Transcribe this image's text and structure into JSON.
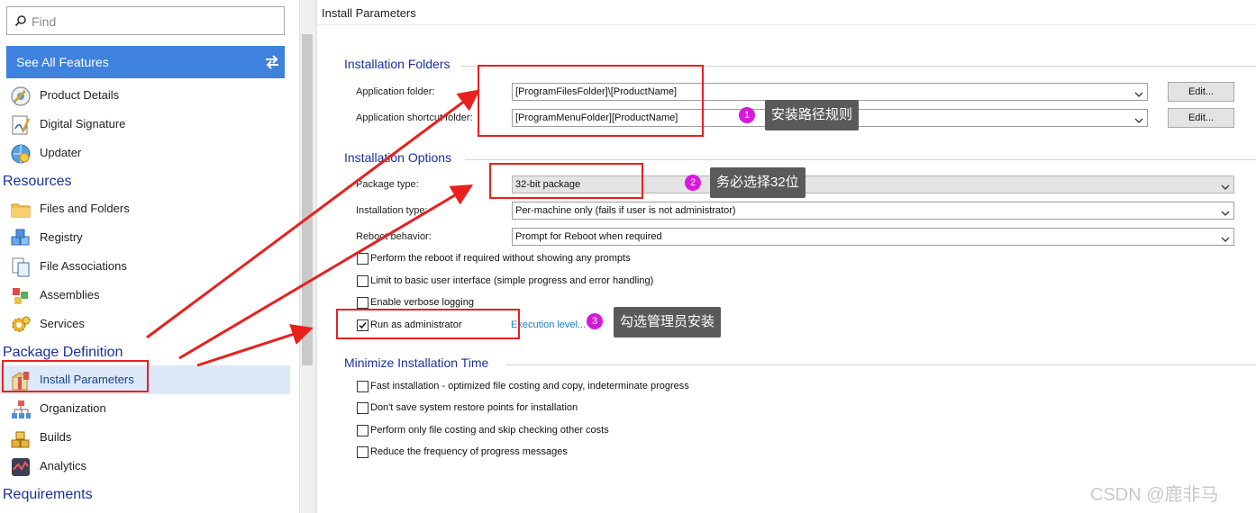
{
  "sidebar": {
    "search_placeholder": "Find",
    "see_all": "See All Features",
    "items_top": [
      {
        "label": "Product Details",
        "icon": "product-details-icon"
      },
      {
        "label": "Digital Signature",
        "icon": "digital-signature-icon"
      },
      {
        "label": "Updater",
        "icon": "updater-icon"
      }
    ],
    "sections": {
      "resources": "Resources",
      "package_definition": "Package Definition",
      "requirements": "Requirements"
    },
    "resources_items": [
      {
        "label": "Files and Folders",
        "icon": "folder-icon"
      },
      {
        "label": "Registry",
        "icon": "registry-icon"
      },
      {
        "label": "File Associations",
        "icon": "file-associations-icon"
      },
      {
        "label": "Assemblies",
        "icon": "assemblies-icon"
      },
      {
        "label": "Services",
        "icon": "services-gear-icon"
      }
    ],
    "package_items": [
      {
        "label": "Install Parameters",
        "icon": "install-parameters-icon",
        "selected": true
      },
      {
        "label": "Organization",
        "icon": "organization-icon"
      },
      {
        "label": "Builds",
        "icon": "builds-icon"
      },
      {
        "label": "Analytics",
        "icon": "analytics-icon"
      }
    ]
  },
  "main": {
    "title": "Install Parameters",
    "installation_folders": {
      "title": "Installation Folders",
      "app_folder_label": "Application folder:",
      "app_folder_value": "[ProgramFilesFolder]\\[ProductName]",
      "shortcut_folder_label": "Application shortcut folder:",
      "shortcut_folder_value": "[ProgramMenuFolder][ProductName]",
      "edit_label": "Edit..."
    },
    "installation_options": {
      "title": "Installation Options",
      "package_type_label": "Package type:",
      "package_type_value": "32-bit package",
      "installation_type_label": "Installation type:",
      "installation_type_value": "Per-machine only (fails if user is not administrator)",
      "reboot_label": "Reboot behavior:",
      "reboot_value": "Prompt for Reboot when required",
      "checkboxes": [
        {
          "label": "Perform the reboot if required without showing any prompts",
          "checked": false
        },
        {
          "label": "Limit to basic user interface (simple progress and error handling)",
          "checked": false
        },
        {
          "label": "Enable verbose logging",
          "checked": false
        },
        {
          "label": "Run as administrator",
          "checked": true
        }
      ],
      "execution_level_link": "Execution level..."
    },
    "minimize_installation_time": {
      "title": "Minimize Installation Time",
      "checkboxes": [
        {
          "label": "Fast installation - optimized file costing and copy, indeterminate progress",
          "checked": false
        },
        {
          "label": "Don't save system restore points for installation",
          "checked": false
        },
        {
          "label": "Perform only file costing and skip checking other costs",
          "checked": false
        },
        {
          "label": "Reduce the frequency of progress messages",
          "checked": false
        }
      ]
    }
  },
  "annotations": {
    "notes": [
      {
        "number": "1",
        "text": "安装路径规则"
      },
      {
        "number": "2",
        "text": "务必选择32位"
      },
      {
        "number": "3",
        "text": "勾选管理员安装"
      }
    ],
    "color": "#e8201e",
    "bubble_color": "#d61ad8"
  },
  "watermark": "CSDN @鹿非马",
  "colors": {
    "accent": "#3e82de",
    "section_heading": "#1a2f9e",
    "selected_bg": "#dde9f9",
    "link": "#1b7ec6"
  }
}
